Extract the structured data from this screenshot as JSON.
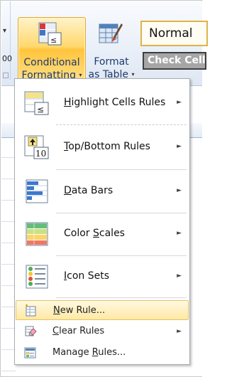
{
  "ribbon": {
    "left_digit": "00",
    "conditional_formatting": {
      "line1": "Conditional",
      "line2": "Formatting"
    },
    "format_as_table": {
      "line1": "Format",
      "line2": "as Table"
    },
    "dropdown_glyph": "▾",
    "styles": {
      "normal": "Normal",
      "check_cell": "Check Cell"
    }
  },
  "menu": {
    "submenu_glyph": "►",
    "items": [
      {
        "pre": "",
        "u": "H",
        "post": "ighlight Cells Rules",
        "icon": "highlight-cells-icon"
      },
      {
        "pre": "",
        "u": "T",
        "post": "op/Bottom Rules",
        "icon": "top-bottom-icon",
        "icon_number": "10"
      },
      {
        "pre": "",
        "u": "D",
        "post": "ata Bars",
        "icon": "data-bars-icon"
      },
      {
        "pre": "Color ",
        "u": "S",
        "post": "cales",
        "icon": "color-scales-icon"
      },
      {
        "pre": "",
        "u": "I",
        "post": "con Sets",
        "icon": "icon-sets-icon"
      },
      {
        "pre": "",
        "u": "N",
        "post": "ew Rule...",
        "icon": "new-rule-icon"
      },
      {
        "pre": "",
        "u": "C",
        "post": "lear Rules",
        "icon": "clear-rules-icon"
      },
      {
        "pre": "Manage ",
        "u": "R",
        "post": "ules...",
        "icon": "manage-rules-icon"
      }
    ]
  },
  "colors": {
    "hover_fill": "#ffe9a5",
    "hover_border": "#e5c365",
    "ribbon_text": "#1e3a6e"
  }
}
